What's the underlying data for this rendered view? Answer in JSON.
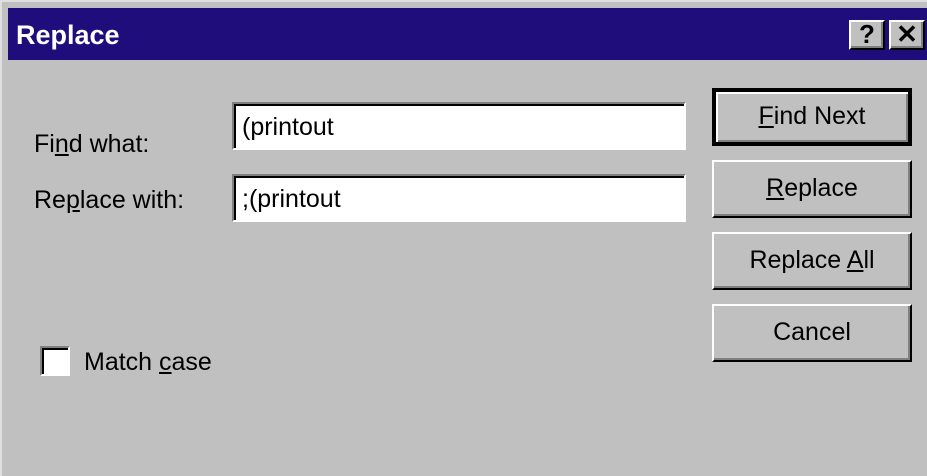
{
  "window": {
    "title": "Replace",
    "help_glyph": "?",
    "close_glyph": "✕",
    "title_color": "#1f0d7c"
  },
  "find": {
    "label_pre": "Fi",
    "label_accel": "n",
    "label_post": "d what:",
    "value": "(printout"
  },
  "replace": {
    "label_pre": "Re",
    "label_accel": "p",
    "label_post": "lace with:",
    "value": ";(printout"
  },
  "match_case": {
    "label_pre": "Match ",
    "label_accel": "c",
    "label_post": "ase",
    "checked": false
  },
  "buttons": {
    "find_next": {
      "accel": "F",
      "rest": "ind Next"
    },
    "replace": {
      "accel": "R",
      "rest": "eplace"
    },
    "replace_all": {
      "pre": "Replace ",
      "accel": "A",
      "rest": "ll"
    },
    "cancel": {
      "label": "Cancel"
    }
  }
}
